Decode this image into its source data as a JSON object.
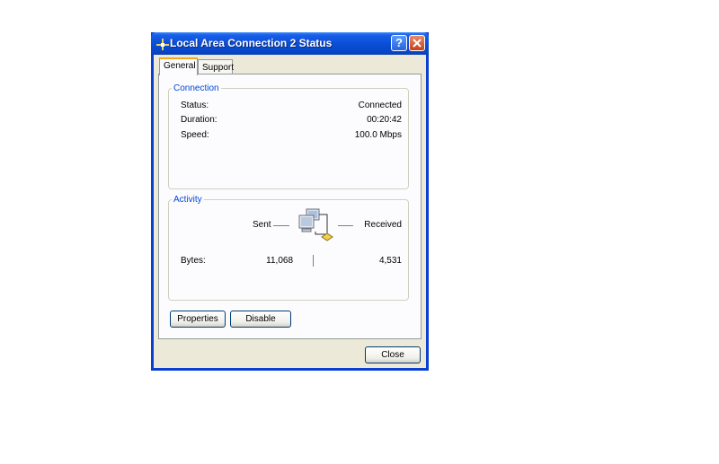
{
  "window": {
    "title": "Local Area Connection 2 Status",
    "help_label": "?",
    "icon": "network-connection-icon"
  },
  "tabs": [
    {
      "label": "General",
      "active": true
    },
    {
      "label": "Support",
      "active": false
    }
  ],
  "connection": {
    "legend": "Connection",
    "rows": [
      {
        "label": "Status:",
        "value": "Connected"
      },
      {
        "label": "Duration:",
        "value": "00:20:42"
      },
      {
        "label": "Speed:",
        "value": "100.0 Mbps"
      }
    ]
  },
  "activity": {
    "legend": "Activity",
    "sent_label": "Sent",
    "received_label": "Received",
    "bytes_label": "Bytes:",
    "bytes_sent": "11,068",
    "bytes_received": "4,531",
    "icon": "network-computers-icon"
  },
  "buttons": {
    "properties": "Properties",
    "disable": "Disable",
    "close": "Close"
  },
  "colors": {
    "titlebar": "#0a4fd8",
    "legend": "#0046d5",
    "dialog_bg": "#ece9d8",
    "tab_highlight": "#f5a623"
  }
}
